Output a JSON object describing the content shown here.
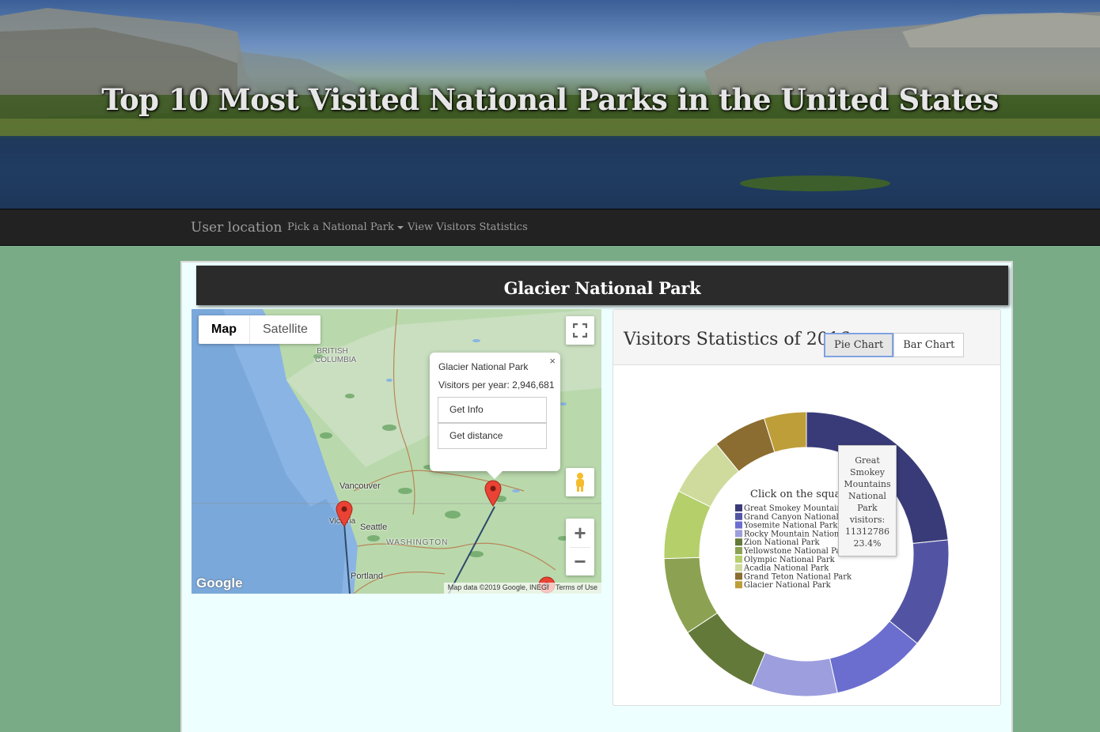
{
  "hero": {
    "title": "Top 10 Most Visited National Parks in the United States"
  },
  "navbar": {
    "brand": "User location",
    "items": [
      {
        "label": "Pick a National Park",
        "dropdown": true
      },
      {
        "label": "View Visitors Statistics",
        "dropdown": false
      }
    ]
  },
  "park": {
    "title": "Glacier National Park"
  },
  "map": {
    "type_buttons": [
      "Map",
      "Satellite"
    ],
    "active_type": "Map",
    "labels": {
      "british_columbia": "BRITISH\nCOLUMBIA",
      "vancouver": "Vancouver",
      "victoria": "Victoria",
      "seattle": "Seattle",
      "washington": "WASHINGTON",
      "portland": "Portland"
    },
    "popup": {
      "title": "Glacier National Park",
      "visitors": "Visitors per year: 2,946,681",
      "buttons": [
        "Get Info",
        "Get distance"
      ],
      "close": "×"
    },
    "footer": "Map data ©2019 Google, INEGI",
    "terms": "Terms of Use",
    "logo": "Google",
    "zoom_in": "+",
    "zoom_out": "−",
    "icons": [
      "fullscreen-icon",
      "pegman-icon",
      "map-pin-icon"
    ]
  },
  "stats": {
    "title": "Visitors Statistics of 2016",
    "buttons": [
      "Pie Chart",
      "Bar Chart"
    ],
    "active": "Pie Chart"
  },
  "chart_data": {
    "type": "pie",
    "donut": true,
    "center_text": "Click on the squares",
    "labels": [
      "Great Smokey Mountains",
      "Grand Canyon National Park",
      "Yosemite National Park",
      "Rocky Mountain National",
      "Zion National Park",
      "Yellowstone National Park",
      "Olympic National Park",
      "Acadia National Park",
      "Grand Teton National Park",
      "Glacier National Park"
    ],
    "values": [
      23.4,
      12.4,
      10.7,
      9.8,
      9.4,
      8.8,
      7.8,
      6.8,
      6.1,
      4.8
    ],
    "colors": [
      "#393b79",
      "#5254a3",
      "#6b6ecf",
      "#9c9ede",
      "#637939",
      "#8ca252",
      "#b5cf6b",
      "#cedb9c",
      "#8c6d31",
      "#bd9e39"
    ],
    "tooltip": {
      "lines": [
        "Great",
        "Smokey",
        "Mountains",
        "National",
        "Park",
        "visitors:",
        "11312786",
        "23.4%"
      ]
    }
  }
}
